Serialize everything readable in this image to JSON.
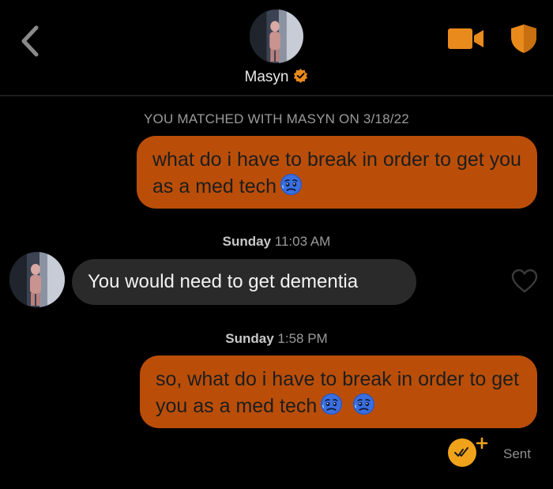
{
  "header": {
    "contact_name": "Masyn",
    "verified": true
  },
  "match_banner": "YOU MATCHED WITH MASYN ON 3/18/22",
  "messages": [
    {
      "direction": "outgoing",
      "text": "what do i have to break in order to get you as a med tech",
      "emoji_count": 1
    },
    {
      "timestamp_day": "Sunday",
      "timestamp_time": "11:03 AM"
    },
    {
      "direction": "incoming",
      "text": "You would need to get dementia"
    },
    {
      "timestamp_day": "Sunday",
      "timestamp_time": "1:58 PM"
    },
    {
      "direction": "outgoing",
      "text": "so, what do i have to break in order to get you as a med tech",
      "emoji_count": 2
    }
  ],
  "status": {
    "label": "Sent"
  },
  "colors": {
    "accent": "#e98a1d",
    "outgoing_bubble": "#ba4e08",
    "incoming_bubble": "#2a2a2a",
    "background": "#000000"
  },
  "icons": [
    "back-chevron-icon",
    "video-call-icon",
    "shield-icon",
    "verified-badge-icon",
    "heart-icon",
    "read-receipt-icon",
    "weary-face-emoji"
  ]
}
